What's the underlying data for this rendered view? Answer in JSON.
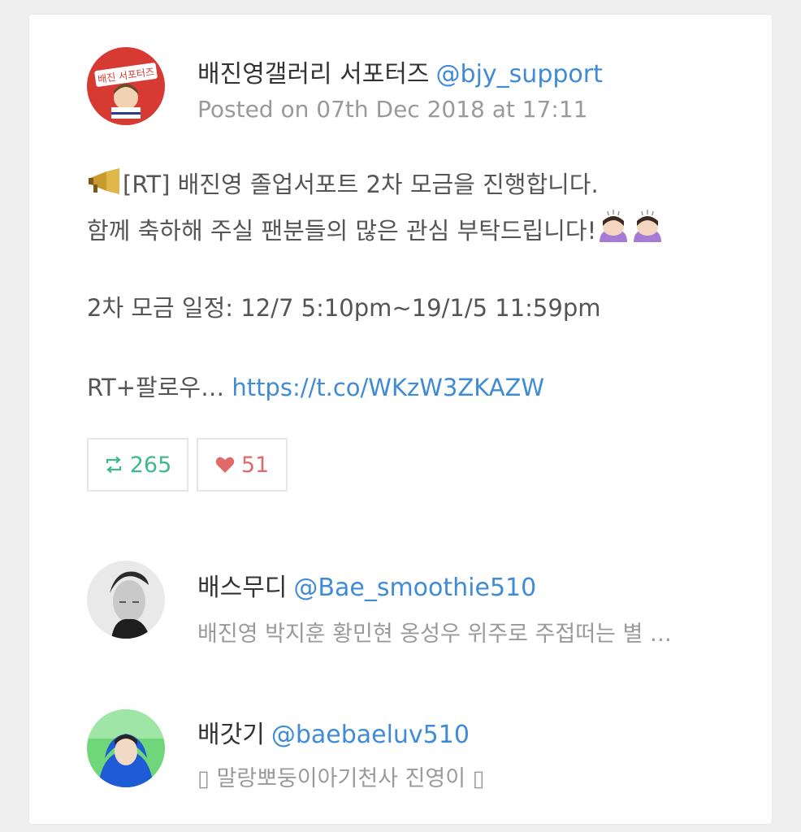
{
  "post": {
    "author_name": "배진영갤러리 서포터즈",
    "author_handle": "@bjy_support",
    "posted": "Posted on 07th Dec 2018 at 17:11",
    "line1": "[RT] 배진영 졸업서포트 2차 모금을 진행합니다.",
    "line2": "함께 축하해 주실 팬분들의 많은 관심 부탁드립니다!",
    "line3": "2차 모금 일정: 12/7 5:10pm~19/1/5 11:59pm",
    "line4_text": "RT+팔로우… ",
    "line4_link": "https://t.co/WKzW3ZKAZW",
    "avatar_text": "배진 서포터즈",
    "icons": [
      "megaphone-icon",
      "bowing-person-icon",
      "bowing-person-icon"
    ]
  },
  "stats": {
    "retweets": "265",
    "likes": "51",
    "retweet_icon": "retweet-icon",
    "like_icon": "heart-icon",
    "retweet_color": "#3fb88a",
    "like_color": "#e06a6a"
  },
  "followers": [
    {
      "name": "배스무디",
      "handle": "@Bae_smoothie510",
      "desc": "배진영 박지훈 황민현 옹성우 위주로 주접떠는 별 …"
    },
    {
      "name": "배갓기",
      "handle": "@baebaeluv510",
      "desc": "▯ 말랑뽀둥이아기천사 진영이 ▯"
    }
  ],
  "colors": {
    "link": "#3f8bd6",
    "muted": "#9a9a9a",
    "body": "#555555",
    "background": "#efefef"
  }
}
